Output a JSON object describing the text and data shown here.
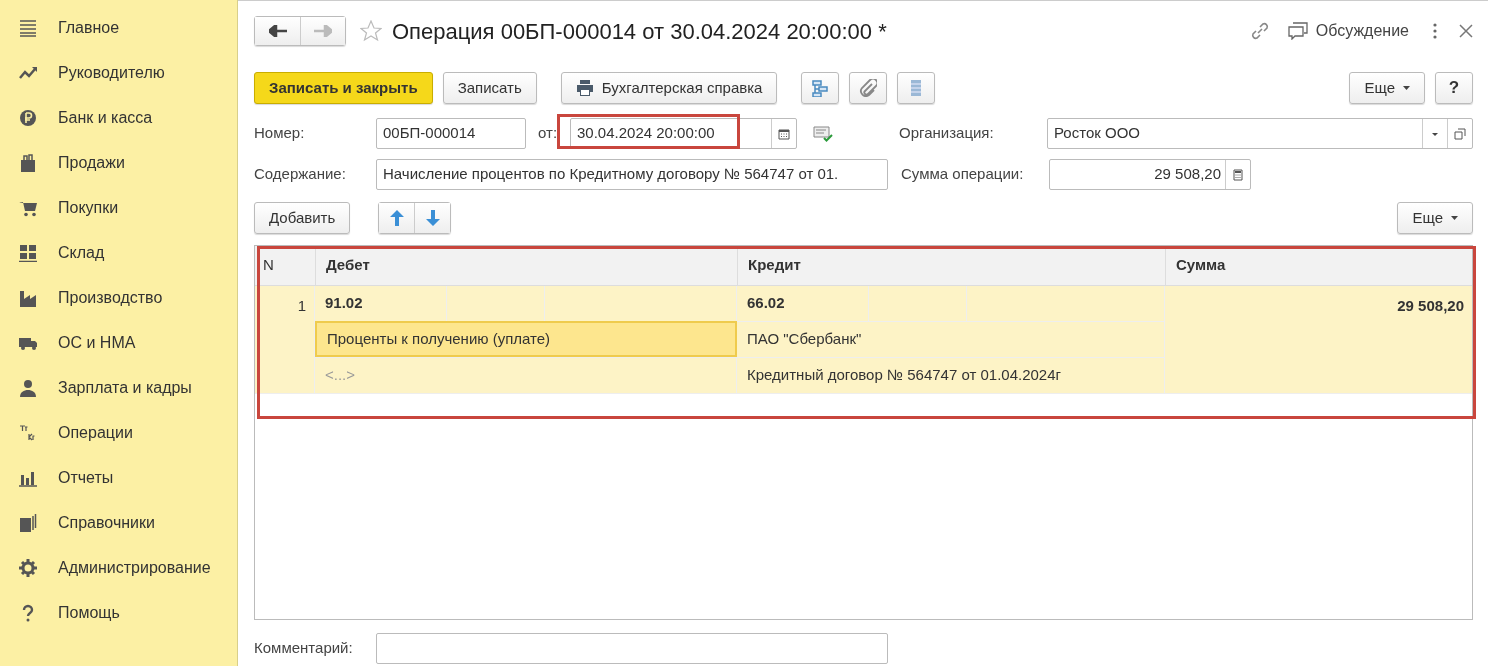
{
  "sidebar": {
    "items": [
      {
        "label": "Главное"
      },
      {
        "label": "Руководителю"
      },
      {
        "label": "Банк и касса"
      },
      {
        "label": "Продажи"
      },
      {
        "label": "Покупки"
      },
      {
        "label": "Склад"
      },
      {
        "label": "Производство"
      },
      {
        "label": "ОС и НМА"
      },
      {
        "label": "Зарплата и кадры"
      },
      {
        "label": "Операции"
      },
      {
        "label": "Отчеты"
      },
      {
        "label": "Справочники"
      },
      {
        "label": "Администрирование"
      },
      {
        "label": "Помощь"
      }
    ]
  },
  "title_bar": {
    "title": "Операция 00БП-000014 от 30.04.2024 20:00:00 *",
    "discussion": "Обсуждение"
  },
  "toolbar": {
    "buttons": [
      {
        "label": "Записать и закрыть",
        "kind": "primary"
      },
      {
        "label": "Записать",
        "kind": "plain"
      },
      {
        "label": "Бухгалтерская справка",
        "kind": "print"
      }
    ],
    "more": "Еще",
    "help": "?"
  },
  "form": {
    "number_label": "Номер:",
    "number": "00БП-000014",
    "date_label": "от:",
    "date": "30.04.2024 20:00:00",
    "date_highlighted": true,
    "organization_label": "Организация:",
    "organization": "Росток ООО",
    "content_label": "Содержание:",
    "content": "Начисление процентов по Кредитному договору № 564747 от 01.",
    "sum_label": "Сумма операции:",
    "sum": "29 508,20"
  },
  "table_toolbar": {
    "add": "Добавить",
    "more": "Еще"
  },
  "table": {
    "highlighted": true,
    "columns": [
      "N",
      "Дебет",
      "Кредит",
      "Сумма"
    ],
    "rows": [
      {
        "n": "1",
        "selected": true,
        "debit": {
          "account": "91.02",
          "subconto": [
            {
              "text": "Проценты к получению (уплате)",
              "selected": true
            },
            {
              "text": "<...>",
              "selected": false
            }
          ]
        },
        "credit": {
          "account": "66.02",
          "subconto": [
            {
              "text": "ПАО \"Сбербанк\"",
              "selected": false
            },
            {
              "text": "Кредитный договор № 564747 от 01.04.2024г",
              "selected": false
            }
          ]
        },
        "sum": "29 508,20"
      }
    ]
  },
  "comment": {
    "label": "Комментарий:"
  }
}
